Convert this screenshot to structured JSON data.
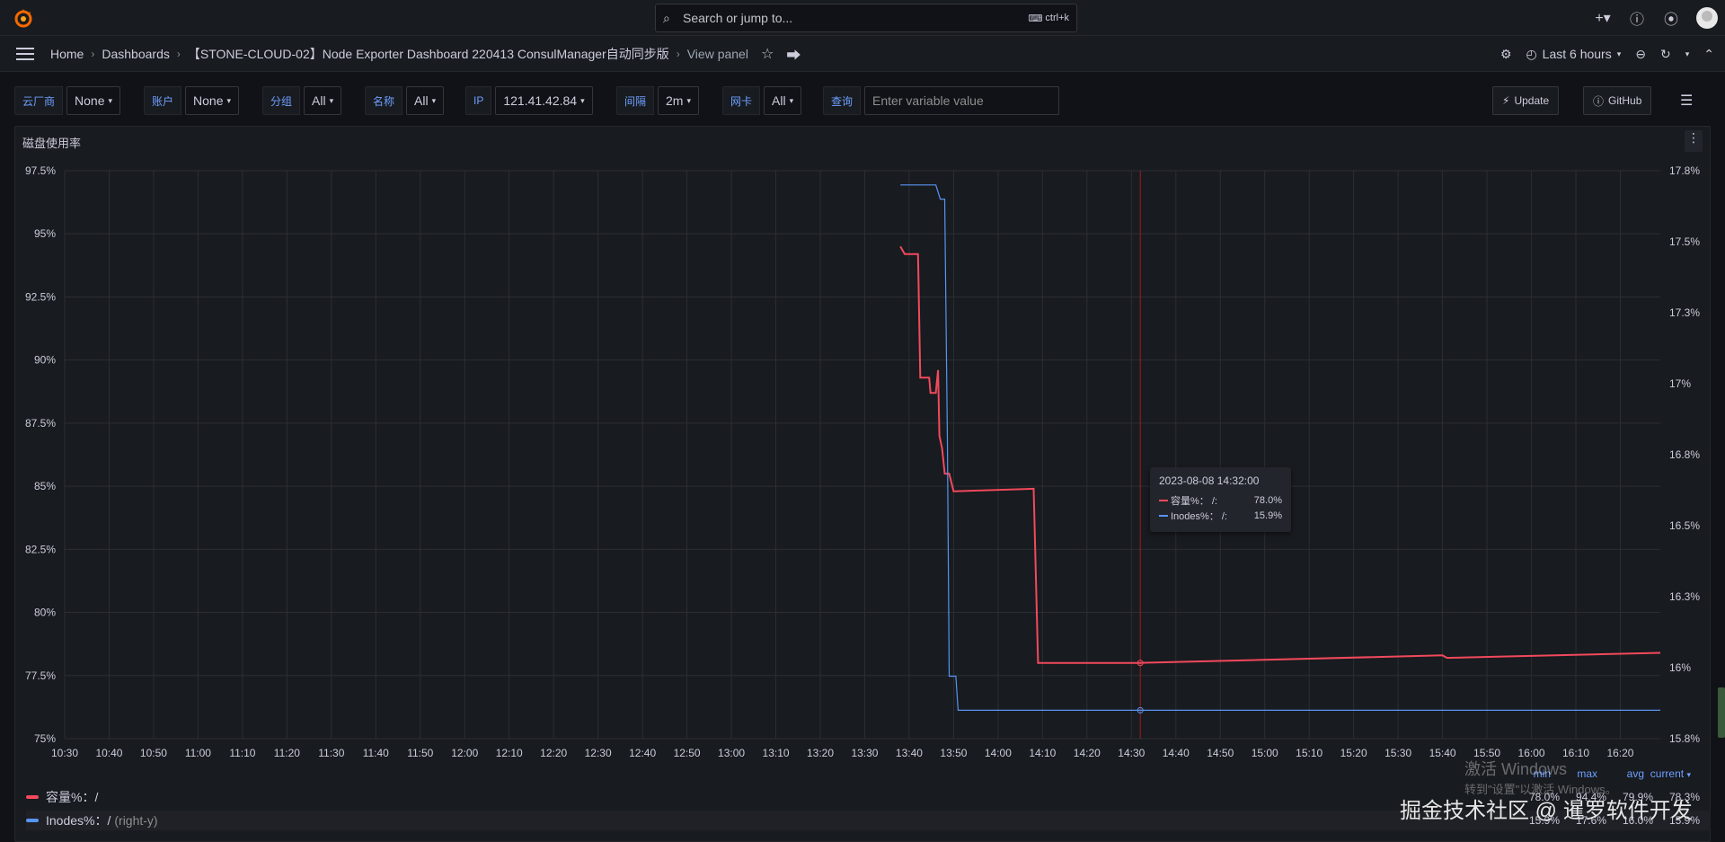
{
  "topbar": {
    "search_placeholder": "Search or jump to...",
    "search_shortcut": "ctrl+k",
    "plus_icon": "plus-icon",
    "help_icon": "help-icon",
    "news_icon": "rss-icon"
  },
  "nav": {
    "breadcrumbs": [
      "Home",
      "Dashboards",
      "【STONE-CLOUD-02】Node Exporter Dashboard 220413 ConsulManager自动同步版",
      "View panel"
    ],
    "time_range": "Last 6 hours"
  },
  "variables": [
    {
      "label": "云厂商",
      "value": "None"
    },
    {
      "label": "账户",
      "value": "None"
    },
    {
      "label": "分组",
      "value": "All"
    },
    {
      "label": "名称",
      "value": "All"
    },
    {
      "label": "IP",
      "value": "121.41.42.84"
    },
    {
      "label": "间隔",
      "value": "2m"
    },
    {
      "label": "网卡",
      "value": "All"
    },
    {
      "label": "查询",
      "placeholder": "Enter variable value"
    }
  ],
  "buttons": {
    "update": "Update",
    "github": "GitHub"
  },
  "panel": {
    "title": "磁盘使用率"
  },
  "colors": {
    "series1": "#f2495c",
    "series2": "#5794f2",
    "accent": "#6e9fff",
    "crosshair": "#a01c25"
  },
  "chart_data": {
    "type": "line",
    "title": "磁盘使用率",
    "x_ticks": [
      "10:30",
      "10:40",
      "10:50",
      "11:00",
      "11:10",
      "11:20",
      "11:30",
      "11:40",
      "11:50",
      "12:00",
      "12:10",
      "12:20",
      "12:30",
      "12:40",
      "12:50",
      "13:00",
      "13:10",
      "13:20",
      "13:30",
      "13:40",
      "13:50",
      "14:00",
      "14:10",
      "14:20",
      "14:30",
      "14:40",
      "14:50",
      "15:00",
      "15:10",
      "15:20",
      "15:30",
      "15:40",
      "15:50",
      "16:00",
      "16:10",
      "16:20"
    ],
    "xlim": [
      "10:30",
      "16:29"
    ],
    "left_axis": {
      "ticks": [
        "97.5%",
        "95%",
        "92.5%",
        "90%",
        "87.5%",
        "85%",
        "82.5%",
        "80%",
        "77.5%",
        "75%"
      ],
      "ylim": [
        75,
        97.5
      ]
    },
    "right_axis": {
      "ticks": [
        "17.8%",
        "17.5%",
        "17.3%",
        "17%",
        "16.8%",
        "16.5%",
        "16.3%",
        "16%",
        "15.8%"
      ],
      "ylim": [
        15.8,
        17.8
      ]
    },
    "series": [
      {
        "name": "容量%：/",
        "axis": "left",
        "points": [
          [
            "13:38",
            94.5
          ],
          [
            "13:39",
            94.2
          ],
          [
            "13:42",
            94.2
          ],
          [
            "13:42.5",
            89.3
          ],
          [
            "13:44.5",
            89.3
          ],
          [
            "13:44.8",
            88.7
          ],
          [
            "13:46",
            88.7
          ],
          [
            "13:46.5",
            89.6
          ],
          [
            "13:46.8",
            87.0
          ],
          [
            "13:47.4",
            86.5
          ],
          [
            "13:48",
            85.5
          ],
          [
            "13:49",
            85.5
          ],
          [
            "13:50",
            84.8
          ],
          [
            "14:08",
            84.9
          ],
          [
            "14:09",
            78.0
          ],
          [
            "14:32",
            78.0
          ],
          [
            "15:40",
            78.3
          ],
          [
            "15:41",
            78.2
          ],
          [
            "16:29",
            78.4
          ]
        ],
        "legend_values": {
          "min": "78.0%",
          "max": "94.4%",
          "avg": "79.9%",
          "current": "78.3%"
        }
      },
      {
        "name": "Inodes%：/",
        "axis": "right",
        "axis_label": "(right-y)",
        "points": [
          [
            "13:38",
            17.75
          ],
          [
            "13:46",
            17.75
          ],
          [
            "13:47",
            17.7
          ],
          [
            "13:48",
            17.7
          ],
          [
            "13:48.6",
            16.85
          ],
          [
            "13:49",
            16.02
          ],
          [
            "13:50.5",
            16.02
          ],
          [
            "13:51",
            15.9
          ],
          [
            "16:29",
            15.9
          ]
        ],
        "legend_values": {
          "min": "15.9%",
          "max": "17.6%",
          "avg": "16.0%",
          "current": "15.9%"
        }
      }
    ],
    "crosshair_x": "14:32",
    "legend_columns": [
      "min",
      "max",
      "avg",
      "current"
    ],
    "tooltip": {
      "time": "2023-08-08 14:32:00",
      "rows": [
        {
          "name": "容量%：",
          "mount": "/:",
          "value": "78.0%"
        },
        {
          "name": "Inodes%：",
          "mount": "/:",
          "value": "15.9%"
        }
      ]
    }
  },
  "overlay": {
    "windows_line1": "激活 Windows",
    "windows_line2": "转到\"设置\"以激活 Windows。",
    "juejin": "掘金技术社区 @ 暹罗软件开发"
  }
}
